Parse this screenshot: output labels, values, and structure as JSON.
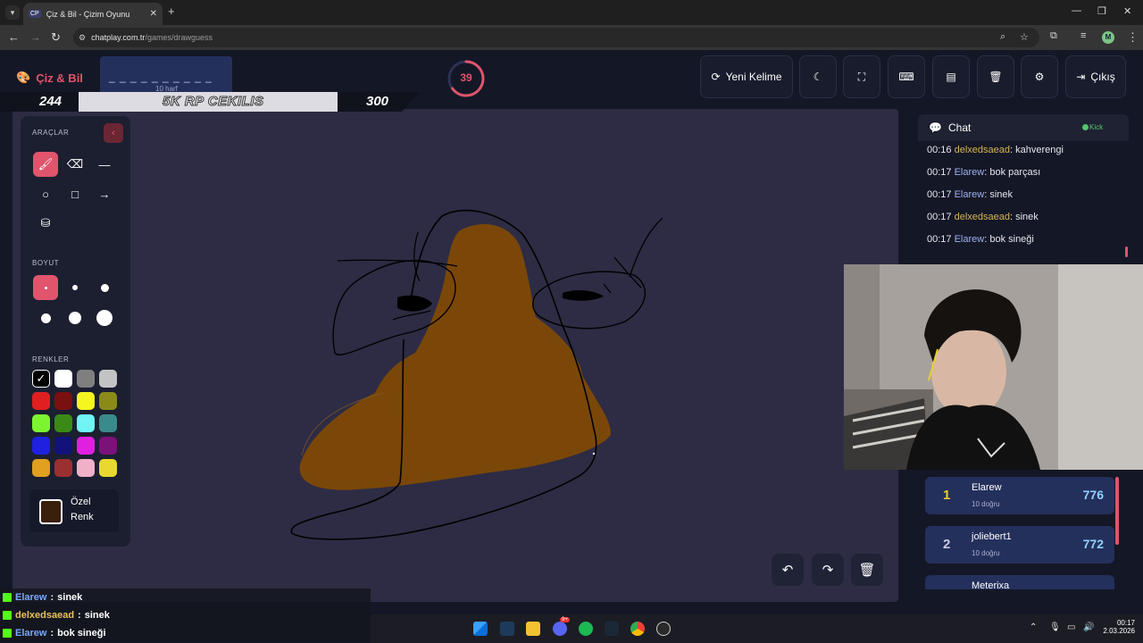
{
  "browser": {
    "tab_title": "Çiz & Bil - Çizim Oyunu",
    "tab_favicon": "CP",
    "tab_close": "✕",
    "new_tab": "+",
    "url_domain": "chatplay.com.tr",
    "url_path": "/games/drawguess",
    "profile_initial": "M"
  },
  "header": {
    "logo_text": "Çiz & Bil",
    "word_mask": "_ _ _ _ _ _ _ _ _ _",
    "word_length": "10 harf",
    "timer": "39",
    "timer_progress": 0.65,
    "buttons": {
      "new_word": "Yeni Kelime",
      "logout": "Çıkış"
    }
  },
  "stream_bar": {
    "left_score": "244",
    "promo": "5K RP CEKILIS",
    "right_score": "300"
  },
  "tools": {
    "section_tools": "ARAÇLAR",
    "section_size": "BOYUT",
    "section_colors": "RENKLER",
    "custom_color_line1": "Özel",
    "custom_color_line2": "Renk",
    "palette": [
      "#000000",
      "#ffffff",
      "#7f7f7f",
      "#c3c3c3",
      "#e02020",
      "#7a1010",
      "#f5f520",
      "#8a8a18",
      "#7cf530",
      "#3a8a18",
      "#6ff5f5",
      "#3a8a8a",
      "#2020e0",
      "#12127a",
      "#e020e0",
      "#7a127a",
      "#e0a020",
      "#9a3030",
      "#f0b0c8",
      "#e8d830"
    ],
    "custom_color": "#3a1f0a",
    "accent": "#e0556c"
  },
  "chat": {
    "title": "Chat",
    "status": "Kick",
    "messages": [
      {
        "time": "00:16",
        "user": "delxedsaead",
        "text": ": kahverengi"
      },
      {
        "time": "00:17",
        "user": "Elarew",
        "text": ": bok parçası"
      },
      {
        "time": "00:17",
        "user": "Elarew",
        "text": ": sinek"
      },
      {
        "time": "00:17",
        "user": "delxedsaead",
        "text": ": sinek"
      },
      {
        "time": "00:17",
        "user": "Elarew",
        "text": ": bok sineği"
      }
    ]
  },
  "leaderboard": [
    {
      "rank": "1",
      "name": "Elarew",
      "correct": "10 doğru",
      "points": "776"
    },
    {
      "rank": "2",
      "name": "joliebert1",
      "correct": "10 doğru",
      "points": "772"
    },
    {
      "rank": "",
      "name": "Meterixa",
      "correct": "",
      "points": ""
    }
  ],
  "overlay_chat": [
    {
      "user": "Elarew",
      "text": "sinek"
    },
    {
      "user": "delxedsaead",
      "text": "sinek"
    },
    {
      "user": "Elarew",
      "text": "bok sineği"
    }
  ],
  "taskbar": {
    "time": "00:17",
    "date": "2.03.2026",
    "discord_badge": "9+"
  }
}
